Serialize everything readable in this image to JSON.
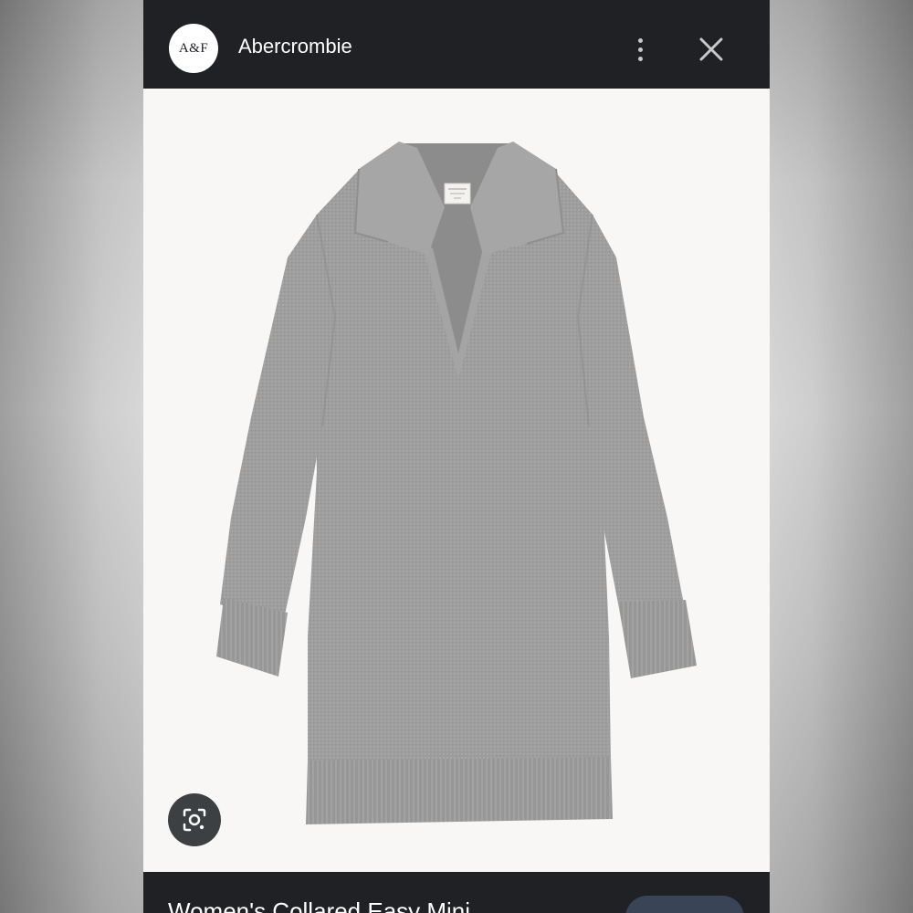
{
  "header": {
    "logo_text": "A&F",
    "site_name": "Abercrombie",
    "more_icon": "more-vert-icon",
    "close_icon": "close-icon"
  },
  "image": {
    "product_color": "#9c9c9c",
    "background_color": "#f8f7f5",
    "label_icon": "clothing-tag-icon"
  },
  "lens": {
    "icon": "lens-search-icon"
  },
  "footer": {
    "product_title": "Women's Collared Easy Mini",
    "visit_label": ""
  },
  "colors": {
    "bar": "#202124",
    "lens_button": "#3c4043",
    "visit_button": "#394457"
  }
}
